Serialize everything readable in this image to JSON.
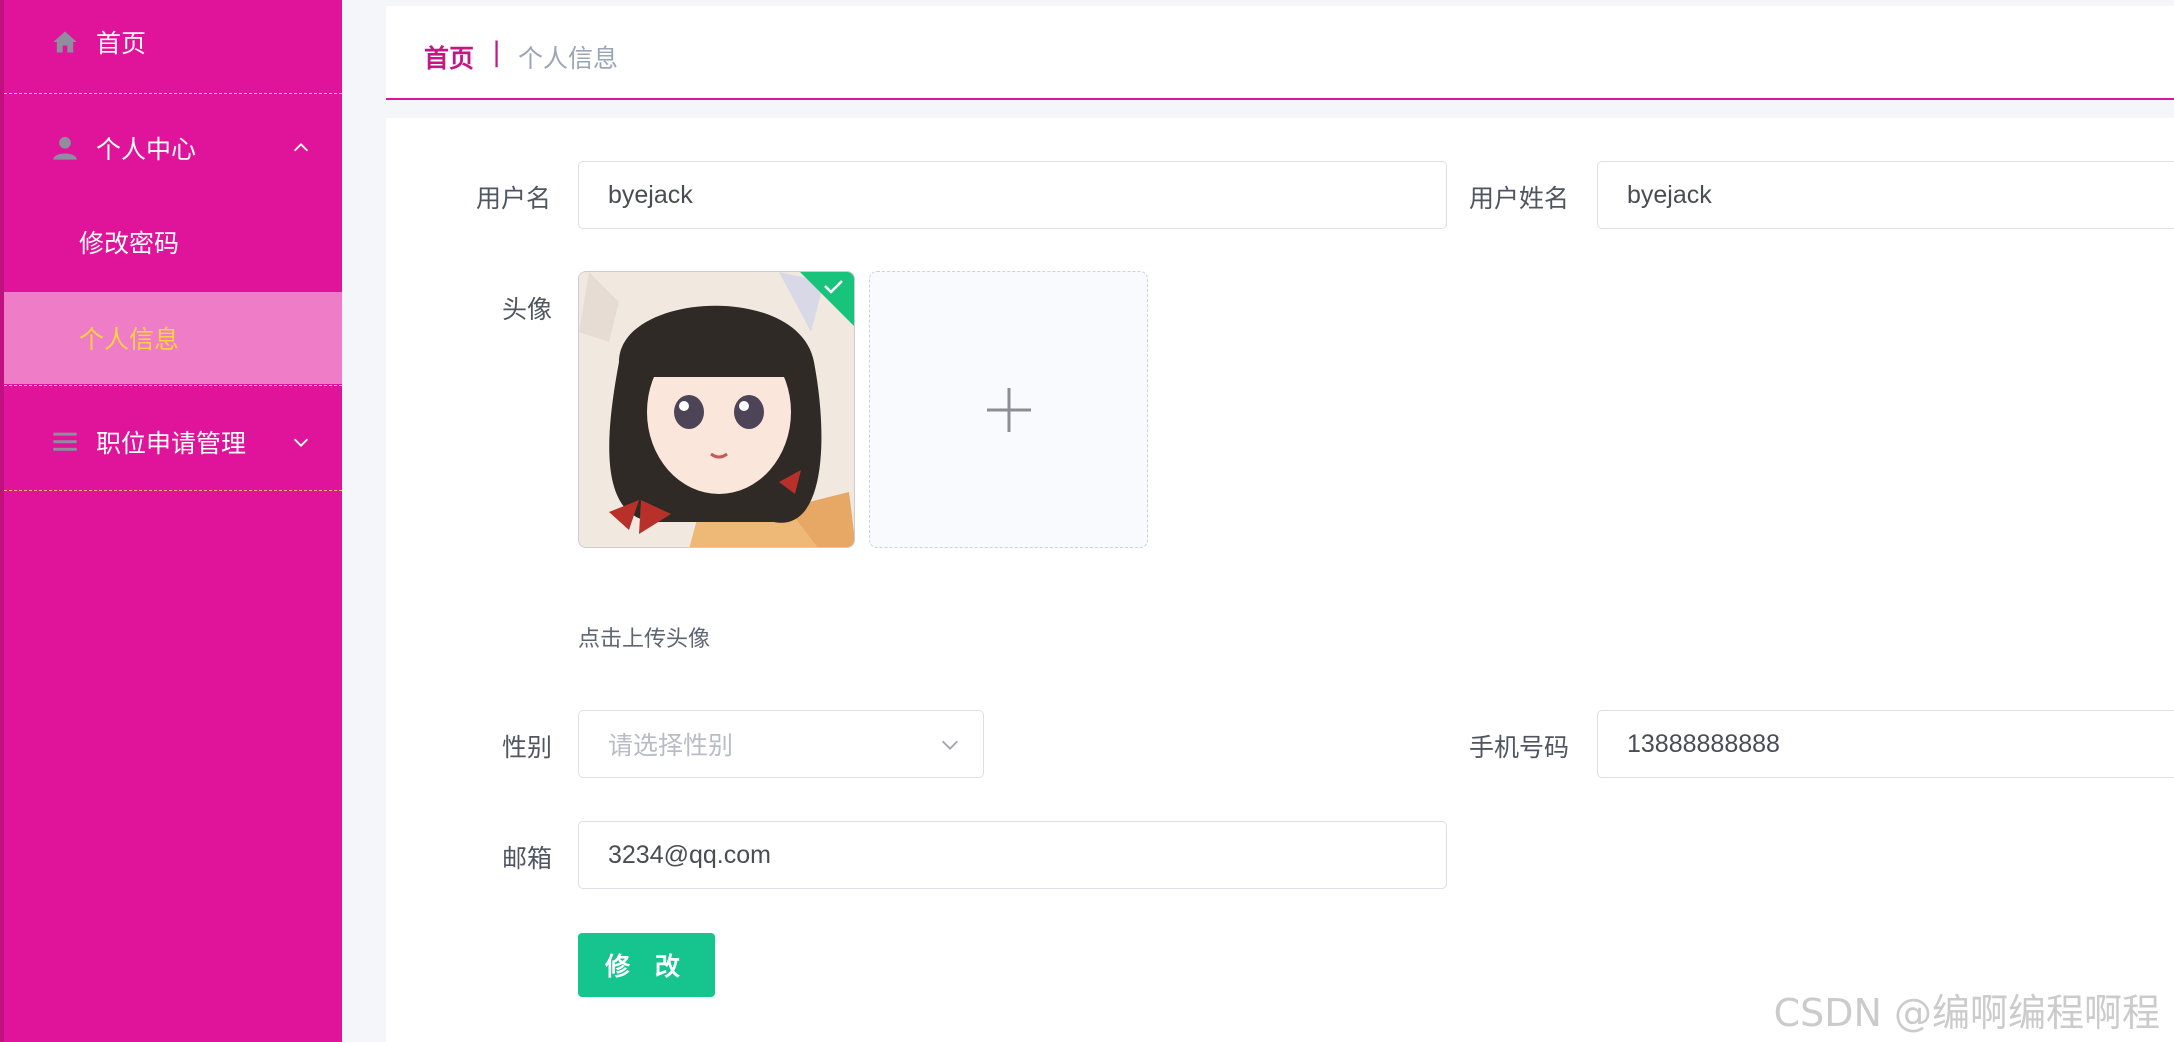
{
  "sidebar": {
    "home": "首页",
    "profile_center": "个人中心",
    "change_password": "修改密码",
    "personal_info": "个人信息",
    "job_apply_mgmt": "职位申请管理"
  },
  "breadcrumb": {
    "home": "首页",
    "separator": "|",
    "current": "个人信息"
  },
  "form": {
    "username_label": "用户名",
    "username_value": "byejack",
    "realname_label": "用户姓名",
    "realname_value": "byejack",
    "avatar_label": "头像",
    "avatar_hint": "点击上传头像",
    "gender_label": "性别",
    "gender_placeholder": "请选择性别",
    "phone_label": "手机号码",
    "phone_value": "13888888888",
    "email_label": "邮箱",
    "email_value": "3234@qq.com",
    "submit_label": "修 改"
  },
  "watermark": "CSDN @编啊编程啊程",
  "colors": {
    "sidebar_bg": "#e0149a",
    "active_item_bg": "#ee7cc6",
    "active_item_text": "#ffd23f",
    "accent": "#c21785",
    "submit_bg": "#16c58d"
  }
}
